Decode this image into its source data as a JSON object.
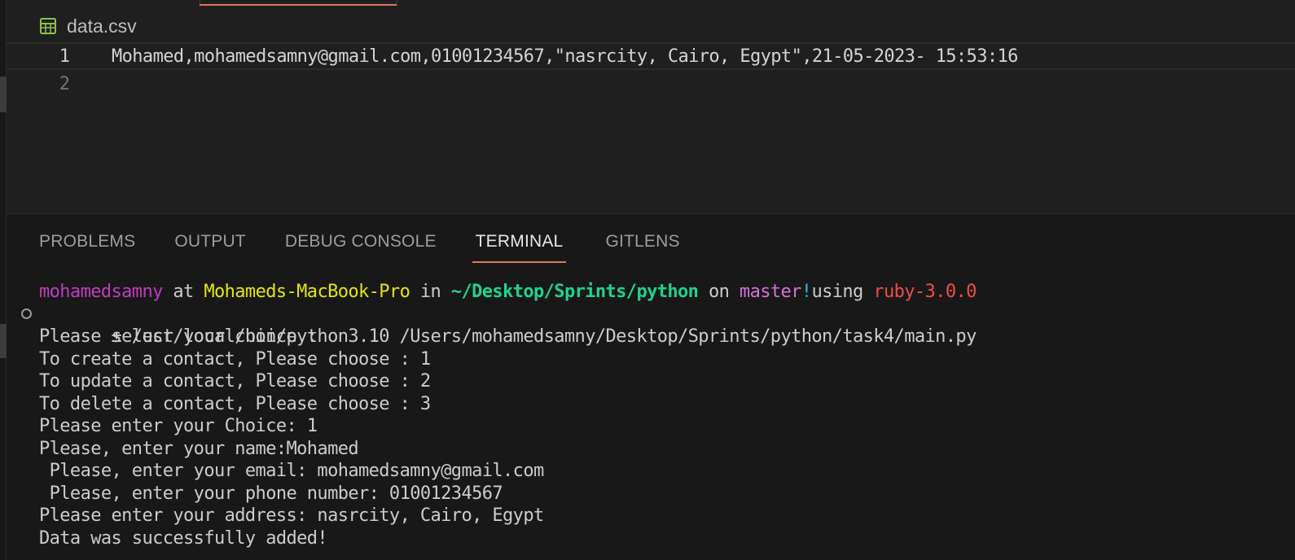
{
  "editor": {
    "file_name": "data.csv",
    "file_icon": "table-icon",
    "lines": [
      {
        "number": "1",
        "text": "Mohamed,mohamedsamny@gmail.com,01001234567,\"nasrcity, Cairo, Egypt\",21-05-2023- 15:53:16"
      },
      {
        "number": "2",
        "text": ""
      }
    ]
  },
  "panel": {
    "tabs": [
      {
        "label": "PROBLEMS"
      },
      {
        "label": "OUTPUT"
      },
      {
        "label": "DEBUG CONSOLE"
      },
      {
        "label": "TERMINAL"
      },
      {
        "label": "GITLENS"
      }
    ],
    "active_tab": "TERMINAL"
  },
  "terminal": {
    "prompt": {
      "user": "mohamedsamny",
      "at": " at ",
      "host": "Mohameds-MacBook-Pro",
      "in": " in ",
      "path": "~/Desktop/Sprints/python",
      "on": " on ",
      "branch": "master",
      "dirty": "!",
      "using": "using ",
      "ruby": "ruby-3.0.0"
    },
    "command": " ± /usr/local/bin/python3.10 /Users/mohamedsamny/Desktop/Sprints/python/task4/main.py",
    "output": [
      "Please select your choice :",
      "To create a contact, Please choose : 1",
      "To update a contact, Please choose : 2",
      "To delete a contact, Please choose : 3",
      "Please enter your Choice: 1",
      "Please, enter your name:Mohamed",
      " Please, enter your email: mohamedsamny@gmail.com",
      " Please, enter your phone number: 01001234567",
      "Please enter your address: nasrcity, Cairo, Egypt",
      "Data was successfully added!"
    ]
  },
  "colors": {
    "accent": "#e0775a",
    "editor_bg": "#1f1f1f",
    "panel_bg": "#181818",
    "csv_icon": "#8bc34a"
  }
}
